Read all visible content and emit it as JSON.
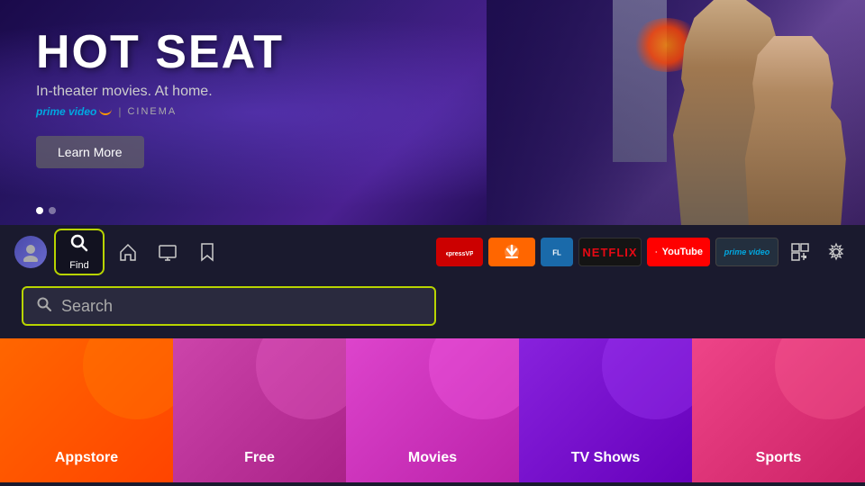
{
  "hero": {
    "title": "HOT SEAT",
    "subtitle": "In-theater movies. At home.",
    "brand": "prime video",
    "divider": "|",
    "category": "CINEMA",
    "learn_more": "Learn More",
    "dots": [
      true,
      false
    ]
  },
  "navbar": {
    "find_label": "Find",
    "icons": {
      "home": "⌂",
      "tv": "📺",
      "bookmark": "🔖"
    },
    "apps": [
      {
        "id": "expressvpn",
        "label": "ExpressVPN"
      },
      {
        "id": "downloader",
        "label": "Downloader"
      },
      {
        "id": "filelinked",
        "label": "FL"
      },
      {
        "id": "netflix",
        "label": "NETFLIX"
      },
      {
        "id": "youtube",
        "label": "YouTube"
      },
      {
        "id": "prime",
        "label": "prime video"
      }
    ]
  },
  "search": {
    "placeholder": "Search",
    "icon": "🔍"
  },
  "categories": [
    {
      "id": "appstore",
      "label": "Appstore"
    },
    {
      "id": "free",
      "label": "Free"
    },
    {
      "id": "movies",
      "label": "Movies"
    },
    {
      "id": "tvshows",
      "label": "TV Shows"
    },
    {
      "id": "sports",
      "label": "Sports"
    }
  ]
}
